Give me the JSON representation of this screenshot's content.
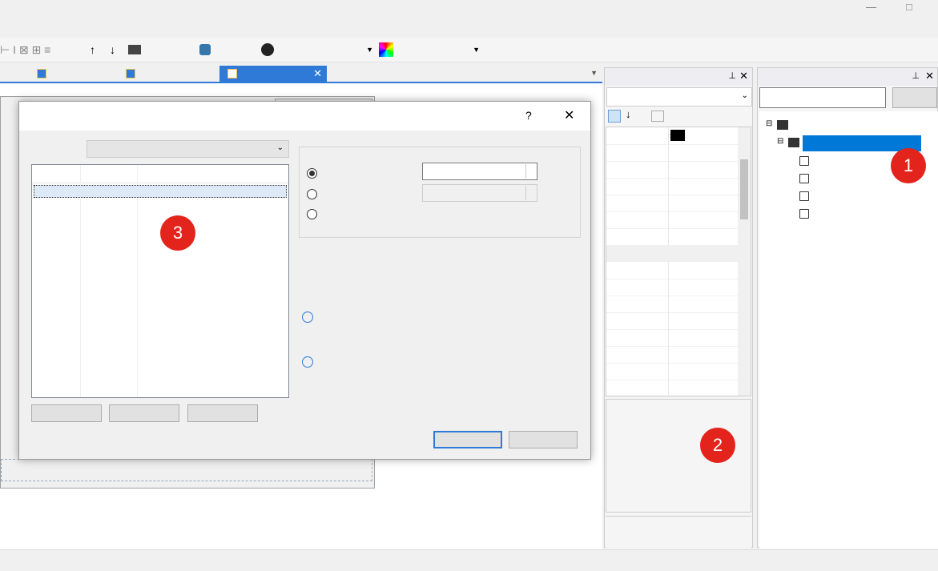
{
  "markers": [
    "1",
    "2",
    "3"
  ],
  "colors": {
    "accent": "#2f7ad6",
    "selection": "#0078d7",
    "marker": "#e3241c"
  }
}
